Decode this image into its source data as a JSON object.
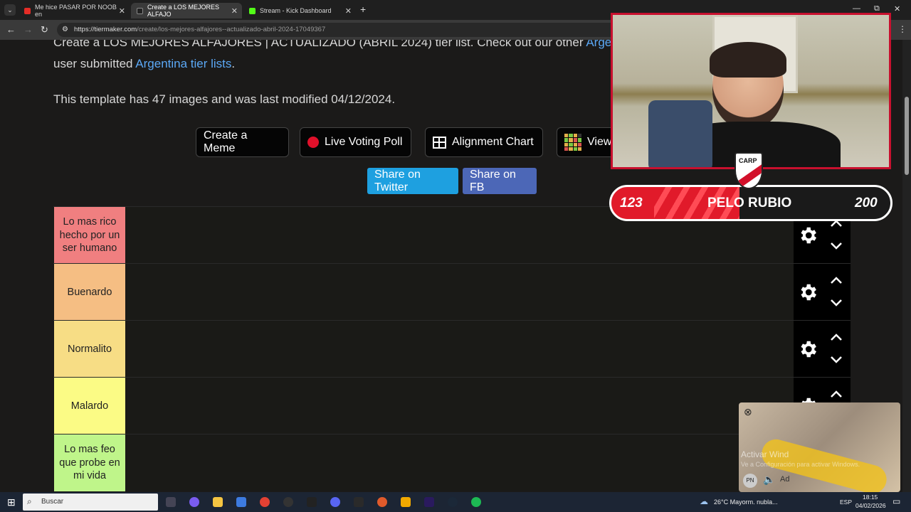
{
  "browser": {
    "tabs": [
      {
        "title": "Me hice PASAR POR NOOB en",
        "favicon_color": "#e52d27"
      },
      {
        "title": "Create a LOS MEJORES ALFAJO",
        "favicon_color": "#111111"
      },
      {
        "title": "Stream - Kick Dashboard",
        "favicon_color": "#53fc18"
      }
    ],
    "new_tab": "+",
    "url_host": "https://tiermaker.com",
    "url_path": "/create/los-mejores-alfajores--actualizado-abril-2024-17049367",
    "window_controls": [
      "—",
      "⧉",
      "✕"
    ]
  },
  "page": {
    "intro_line1": "Create a LOS MEJORES ALFAJORES | ACTUALIZADO (ABRIL 2024) tier list. Check out our other",
    "intro_link1": "Arge",
    "intro_line2_prefix": "user submitted",
    "intro_link2": "Argentina tier lists",
    "intro_line2_suffix": ".",
    "template_info": "This template has 47 images and was last modified 04/12/2024.",
    "buttons": {
      "create_meme": "Create a Meme",
      "live_voting": "Live Voting Poll",
      "alignment": "Alignment Chart",
      "view": "View"
    },
    "share": {
      "twitter": "Share on Twitter",
      "fb": "Share on FB"
    },
    "colors": {
      "twitter": "#1ea0e0",
      "fb": "#4c67b7"
    }
  },
  "tiers": [
    {
      "label": "Lo mas rico hecho por un ser humano",
      "color": "#f07f80"
    },
    {
      "label": "Buenardo",
      "color": "#f5be83"
    },
    {
      "label": "Normalito",
      "color": "#f7dd85"
    },
    {
      "label": "Malardo",
      "color": "#fbfb85"
    },
    {
      "label": "Lo mas feo que probe en mi vida",
      "color": "#bff58a"
    }
  ],
  "overlay": {
    "score_left": "123",
    "streamer_name": "PELO RUBIO",
    "score_right": "200",
    "badge_text": "CARP"
  },
  "ad": {
    "watermark_title": "Activar Wind",
    "watermark_sub": "Ve a Configuración para activar Windows.",
    "badge": "PN",
    "ad_label": "Ad",
    "close": "⊗"
  },
  "taskbar": {
    "search_placeholder": "Buscar",
    "weather": "26°C  Mayorm. nubla...",
    "lang": "ESP",
    "time": "18:15",
    "date": "04/02/2026"
  }
}
